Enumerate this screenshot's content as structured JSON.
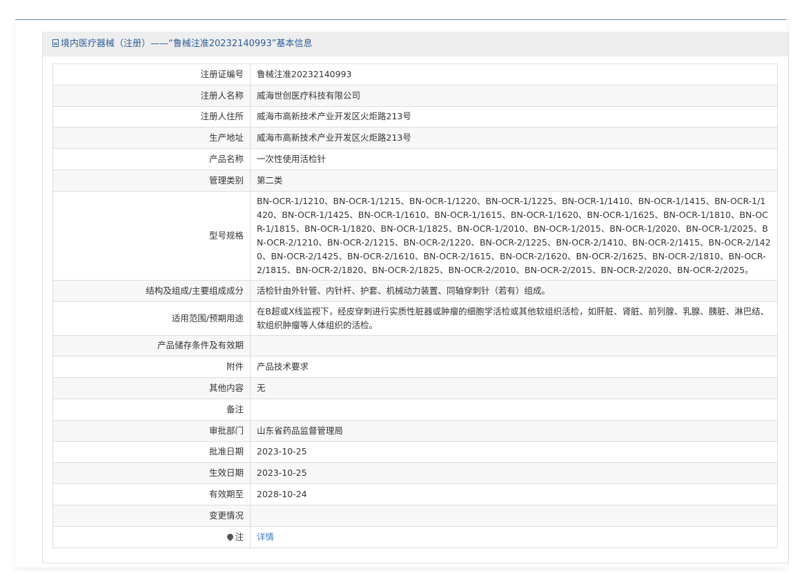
{
  "header": {
    "title": "境内医疗器械（注册）——“鲁械注准20232140993”基本信息",
    "icon": "document-icon"
  },
  "rows": [
    {
      "label": "注册证编号",
      "value": "鲁械注准20232140993"
    },
    {
      "label": "注册人名称",
      "value": "威海世创医疗科技有限公司"
    },
    {
      "label": "注册人住所",
      "value": "威海市高新技术产业开发区火炬路213号"
    },
    {
      "label": "生产地址",
      "value": "威海市高新技术产业开发区火炬路213号"
    },
    {
      "label": "产品名称",
      "value": "一次性使用活检针"
    },
    {
      "label": "管理类别",
      "value": "第二类"
    },
    {
      "label": "型号规格",
      "value": "BN-OCR-1/1210、BN-OCR-1/1215、BN-OCR-1/1220、BN-OCR-1/1225、BN-OCR-1/1410、BN-OCR-1/1415、BN-OCR-1/1420、BN-OCR-1/1425、BN-OCR-1/1610、BN-OCR-1/1615、BN-OCR-1/1620、BN-OCR-1/1625、BN-OCR-1/1810、BN-OCR-1/1815、BN-OCR-1/1820、BN-OCR-1/1825、BN-OCR-1/2010、BN-OCR-1/2015、BN-OCR-1/2020、BN-OCR-1/2025、BN-OCR-2/1210、BN-OCR-2/1215、BN-OCR-2/1220、BN-OCR-2/1225、BN-OCR-2/1410、BN-OCR-2/1415、BN-OCR-2/1420、BN-OCR-2/1425、BN-OCR-2/1610、BN-OCR-2/1615、BN-OCR-2/1620、BN-OCR-2/1625、BN-OCR-2/1810、BN-OCR-2/1815、BN-OCR-2/1820、BN-OCR-2/1825、BN-OCR-2/2010、BN-OCR-2/2015、BN-OCR-2/2020、BN-OCR-2/2025。"
    },
    {
      "label": "结构及组成/主要组成成分",
      "value": "活检针由外针管、内针杆、护套、机械动力装置、同轴穿刺针（若有）组成。"
    },
    {
      "label": "适用范围/预期用途",
      "value": "在B超或X线监视下，经皮穿刺进行实质性脏器或肿瘤的细胞学活检或其他软组织活检，如肝脏、肾脏、前列腺、乳腺、胰脏、淋巴结、软组织肿瘤等人体组织的活检。"
    },
    {
      "label": "产品储存条件及有效期",
      "value": ""
    },
    {
      "label": "附件",
      "value": "产品技术要求"
    },
    {
      "label": "其他内容",
      "value": "无"
    },
    {
      "label": "备注",
      "value": ""
    },
    {
      "label": "审批部门",
      "value": "山东省药品监督管理局"
    },
    {
      "label": "批准日期",
      "value": "2023-10-25"
    },
    {
      "label": "生效日期",
      "value": "2023-10-25"
    },
    {
      "label": "有效期至",
      "value": "2028-10-24"
    },
    {
      "label": "变更情况",
      "value": ""
    }
  ],
  "note": {
    "label": "注",
    "icon": "pin-icon",
    "link_text": "详情"
  }
}
